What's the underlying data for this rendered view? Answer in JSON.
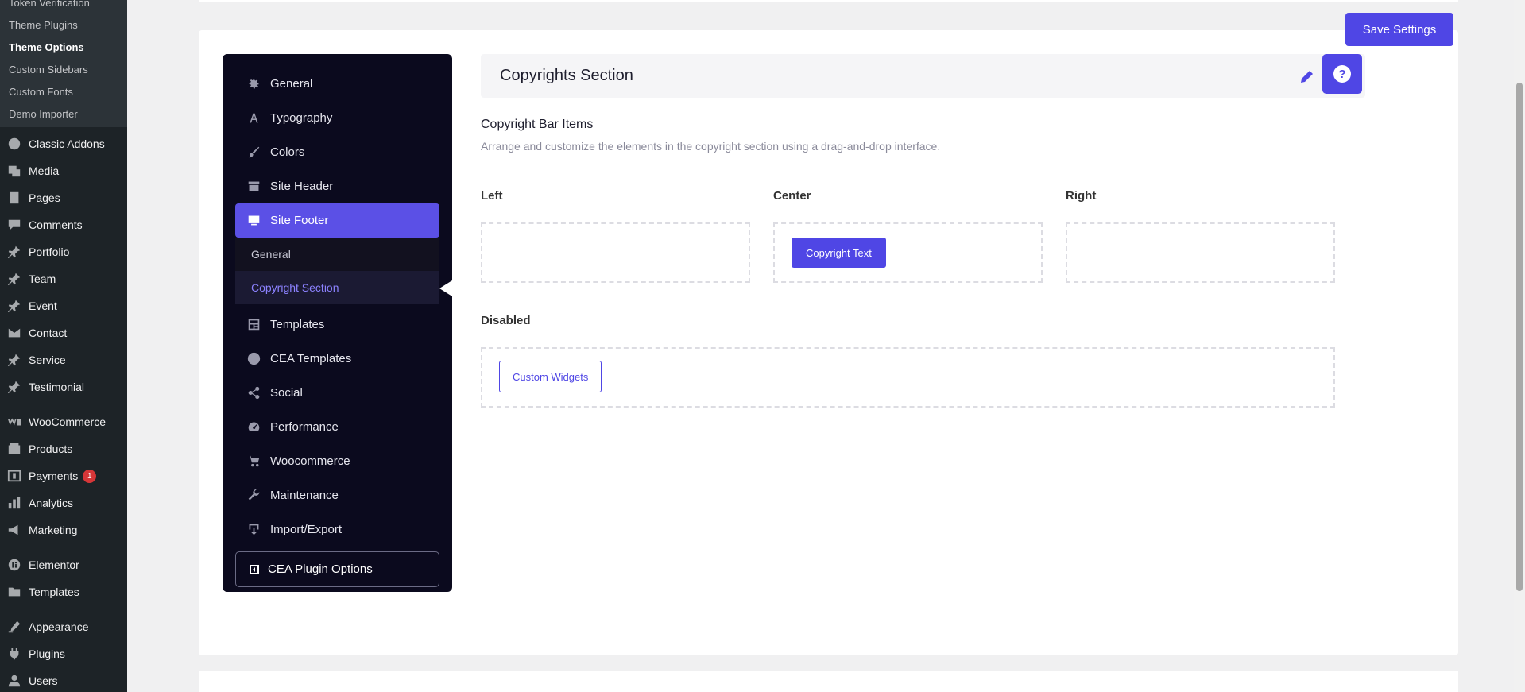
{
  "wp_sidebar": {
    "submenu": [
      "Token Verification",
      "Theme Plugins",
      "Theme Options",
      "Custom Sidebars",
      "Custom Fonts",
      "Demo Importer"
    ],
    "current_sub": "Theme Options",
    "items": [
      {
        "label": "Classic Addons",
        "icon": "classic-addons-icon"
      },
      {
        "label": "Media",
        "icon": "media-icon"
      },
      {
        "label": "Pages",
        "icon": "pages-icon"
      },
      {
        "label": "Comments",
        "icon": "comments-icon"
      },
      {
        "label": "Portfolio",
        "icon": "pin-icon"
      },
      {
        "label": "Team",
        "icon": "pin-icon"
      },
      {
        "label": "Event",
        "icon": "pin-icon"
      },
      {
        "label": "Contact",
        "icon": "mail-icon"
      },
      {
        "label": "Service",
        "icon": "pin-icon"
      },
      {
        "label": "Testimonial",
        "icon": "pin-icon"
      },
      {
        "label": "WooCommerce",
        "icon": "woocommerce-icon"
      },
      {
        "label": "Products",
        "icon": "products-icon"
      },
      {
        "label": "Payments",
        "icon": "payments-icon",
        "badge": "1"
      },
      {
        "label": "Analytics",
        "icon": "analytics-icon"
      },
      {
        "label": "Marketing",
        "icon": "marketing-icon"
      },
      {
        "label": "Elementor",
        "icon": "elementor-icon"
      },
      {
        "label": "Templates",
        "icon": "folder-icon"
      },
      {
        "label": "Appearance",
        "icon": "appearance-icon"
      },
      {
        "label": "Plugins",
        "icon": "plugins-icon"
      },
      {
        "label": "Users",
        "icon": "users-icon"
      }
    ]
  },
  "save_button": "Save Settings",
  "options_nav": {
    "items": [
      {
        "label": "General",
        "icon": "gear-icon"
      },
      {
        "label": "Typography",
        "icon": "typography-icon"
      },
      {
        "label": "Colors",
        "icon": "brush-icon"
      },
      {
        "label": "Site Header",
        "icon": "header-icon"
      },
      {
        "label": "Site Footer",
        "icon": "footer-icon"
      }
    ],
    "sub_items": [
      "General",
      "Copyright Section"
    ],
    "items_after": [
      {
        "label": "Templates",
        "icon": "templates-icon"
      },
      {
        "label": "CEA Templates",
        "icon": "cea-icon"
      },
      {
        "label": "Social",
        "icon": "share-icon"
      },
      {
        "label": "Performance",
        "icon": "speedometer-icon"
      },
      {
        "label": "Woocommerce",
        "icon": "cart-icon"
      },
      {
        "label": "Maintenance",
        "icon": "wrench-icon"
      },
      {
        "label": "Import/Export",
        "icon": "import-export-icon"
      }
    ],
    "cea_plugin": "CEA Plugin Options"
  },
  "section": {
    "title": "Copyrights Section",
    "items_title": "Copyright Bar Items",
    "items_desc": "Arrange and customize the elements in the copyright section using a drag-and-drop interface.",
    "left_label": "Left",
    "center_label": "Center",
    "right_label": "Right",
    "center_item": "Copyright Text",
    "disabled_label": "Disabled",
    "disabled_item": "Custom Widgets",
    "help_glyph": "?"
  },
  "colors": {
    "accent": "#4f46e5",
    "nav_bg": "#0b0a1e",
    "wp_sidebar": "#1d2327"
  }
}
